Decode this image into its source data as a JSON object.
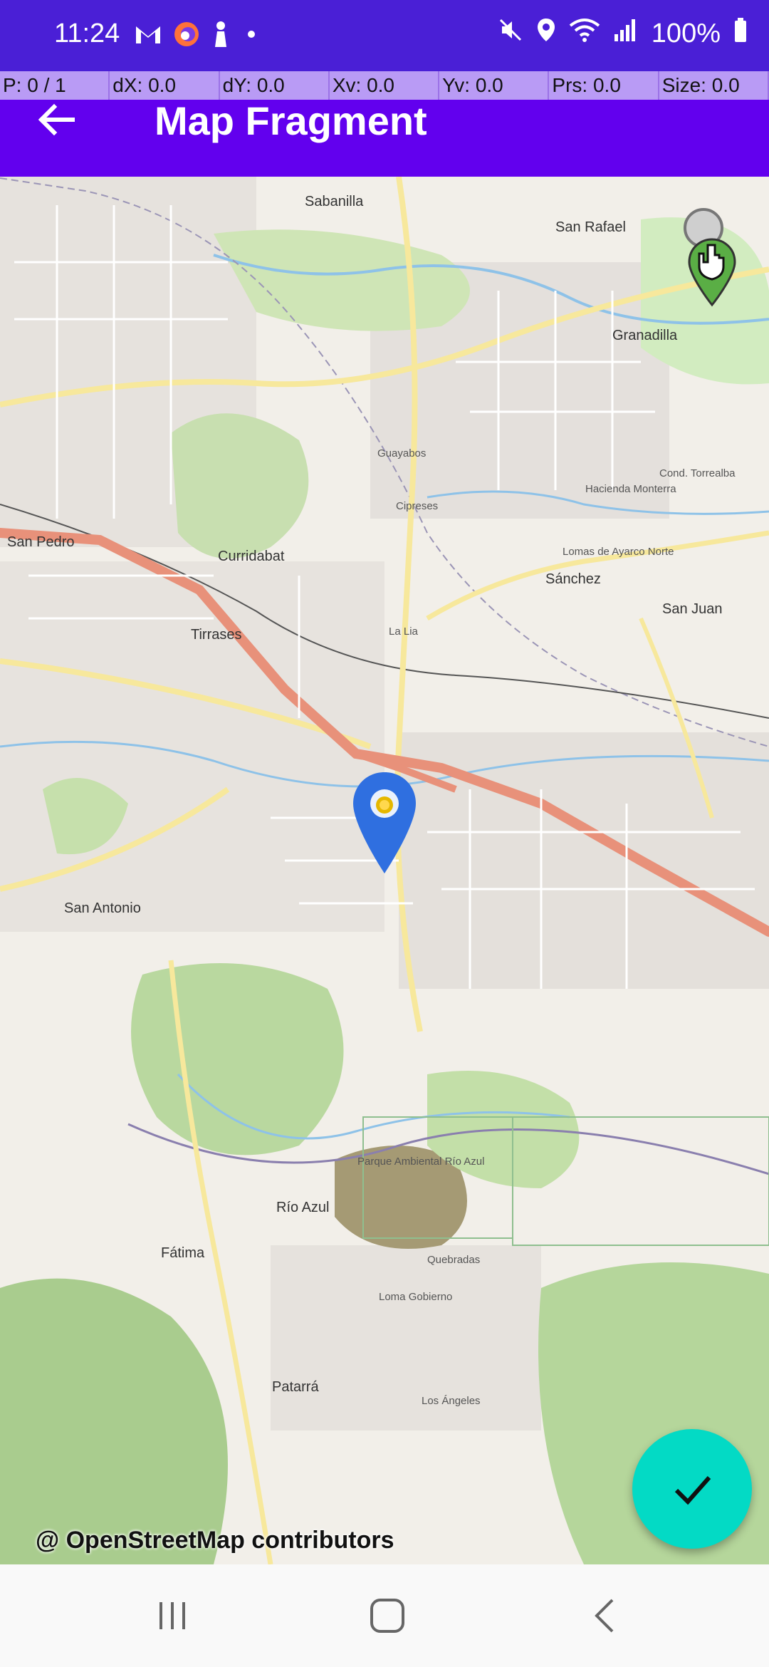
{
  "status": {
    "time": "11:24",
    "battery": "100%",
    "left_icons": [
      "gmail-icon",
      "firefox-icon",
      "accessibility-icon",
      "dot-icon"
    ],
    "right_icons": [
      "mute-icon",
      "location-icon",
      "wifi-icon",
      "signal-icon",
      "battery-icon"
    ]
  },
  "pointer": {
    "p": "P: 0 / 1",
    "dx": "dX: 0.0",
    "dy": "dY: 0.0",
    "xv": "Xv: 0.0",
    "yv": "Yv: 0.0",
    "prs": "Prs: 0.0",
    "size": "Size: 0.0"
  },
  "toolbar": {
    "title": "Map Fragment",
    "back_icon": "arrow-back-icon"
  },
  "map": {
    "attribution": "@ OpenStreetMap contributors",
    "labels": [
      {
        "text": "San Pedro",
        "big": true
      },
      {
        "text": "Curridabat",
        "big": true
      },
      {
        "text": "Sánchez",
        "big": true
      },
      {
        "text": "Granadilla",
        "big": true
      },
      {
        "text": "San Juan",
        "big": true
      },
      {
        "text": "Sabanilla",
        "big": true
      },
      {
        "text": "San Rafael",
        "big": true
      },
      {
        "text": "Tirrases",
        "big": true
      },
      {
        "text": "San Antonio",
        "big": true
      },
      {
        "text": "Río Azul",
        "big": true
      },
      {
        "text": "Fátima",
        "big": true
      },
      {
        "text": "Patarrá",
        "big": true
      },
      {
        "text": "Parque Ambiental Río Azul",
        "big": false
      },
      {
        "text": "Lomas de Ayarco Norte",
        "big": false
      },
      {
        "text": "Cond. Torrealba",
        "big": false
      },
      {
        "text": "Hacienda Monterra",
        "big": false
      },
      {
        "text": "Cipreses",
        "big": false
      },
      {
        "text": "Guayabos",
        "big": false
      },
      {
        "text": "La Lia",
        "big": false
      },
      {
        "text": "Quebradas",
        "big": false
      },
      {
        "text": "Loma Gobierno",
        "big": false
      },
      {
        "text": "Los Ángeles",
        "big": false
      }
    ]
  },
  "fab": {
    "icon": "check-icon"
  },
  "nav": {
    "recents": "recents-icon",
    "home": "home-icon",
    "back": "back-icon"
  },
  "colors": {
    "status_bar": "#4a1fd6",
    "toolbar": "#6200ee",
    "pointer_bar": "#b99bf5",
    "fab": "#03dac5",
    "marker": "#2f6fe0",
    "road_primary": "#e8917a",
    "road_secondary": "#f7e89c"
  }
}
